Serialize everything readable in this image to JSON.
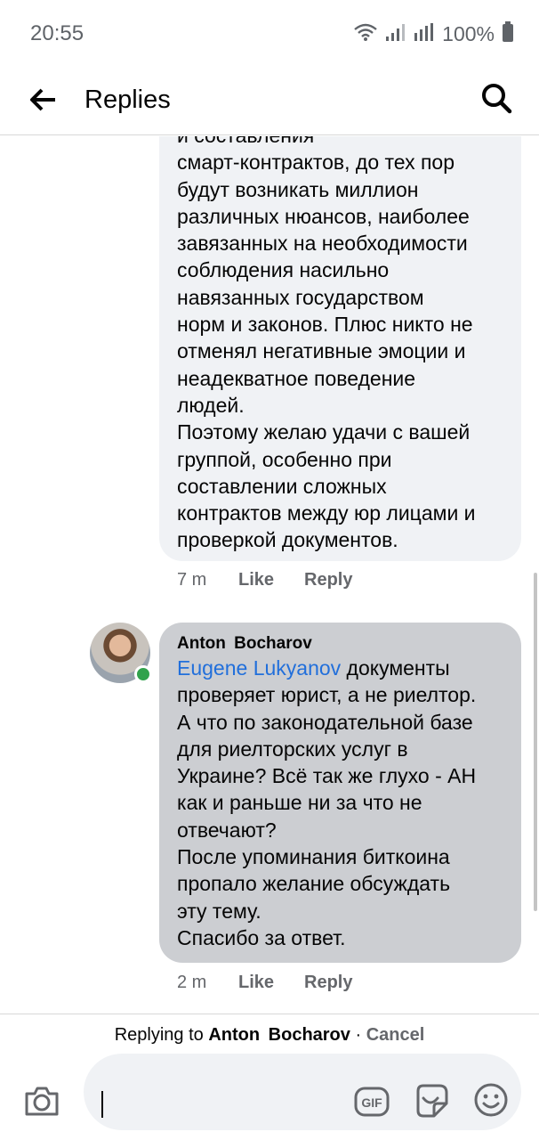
{
  "status_bar": {
    "time": "20:55",
    "battery": "100%",
    "icons": [
      "wifi-icon",
      "signal-icon",
      "signal-icon",
      "battery-icon"
    ]
  },
  "header": {
    "title": "Replies",
    "back_icon": "back-arrow-icon",
    "search_icon": "search-icon"
  },
  "comments": [
    {
      "text_partial_top": "и составления",
      "text": "смарт-контрактов, до тех пор\nбудут возникать миллион\nразличных нюансов, наиболее\nзавязанных на необходимости\nсоблюдения насильно\nнавязанных государством\nнорм и законов. Плюс никто не\nотменял негативные эмоции и\nнеадекватное поведение\nлюдей.\nПоэтому желаю удачи с вашей\nгруппой, особенно при\nсоставлении сложных\nконтрактов между юр лицами и\nпроверкой документов.",
      "time": "7 m",
      "like_label": "Like",
      "reply_label": "Reply"
    },
    {
      "author": "Anton  Bocharov",
      "mention": "Eugene Lukyanov",
      "text_after_mention": " документы\nпроверяет юрист, а не риелтор.\nА что по законодательной базе\nдля риелторских услуг в\nУкраине? Всё так же глухо - АН\nкак и раньше ни за что не\nотвечают?\nПосле упоминания биткоина\nпропало желание обсуждать\nэту тему.\nСпасибо за ответ.",
      "time": "2 m",
      "like_label": "Like",
      "reply_label": "Reply",
      "online": true
    }
  ],
  "composer": {
    "replying_prefix": "Replying to ",
    "replying_name": "Anton  Bocharov",
    "separator": " · ",
    "cancel_label": "Cancel",
    "gif_label": "GIF",
    "icons": [
      "camera-icon",
      "gif-icon",
      "sticker-icon",
      "emoji-icon"
    ]
  },
  "colors": {
    "mention": "#216fdb",
    "bubble_light": "#f0f2f5",
    "bubble_selected": "#ccced2",
    "online": "#31a24c",
    "meta": "#65676b"
  }
}
